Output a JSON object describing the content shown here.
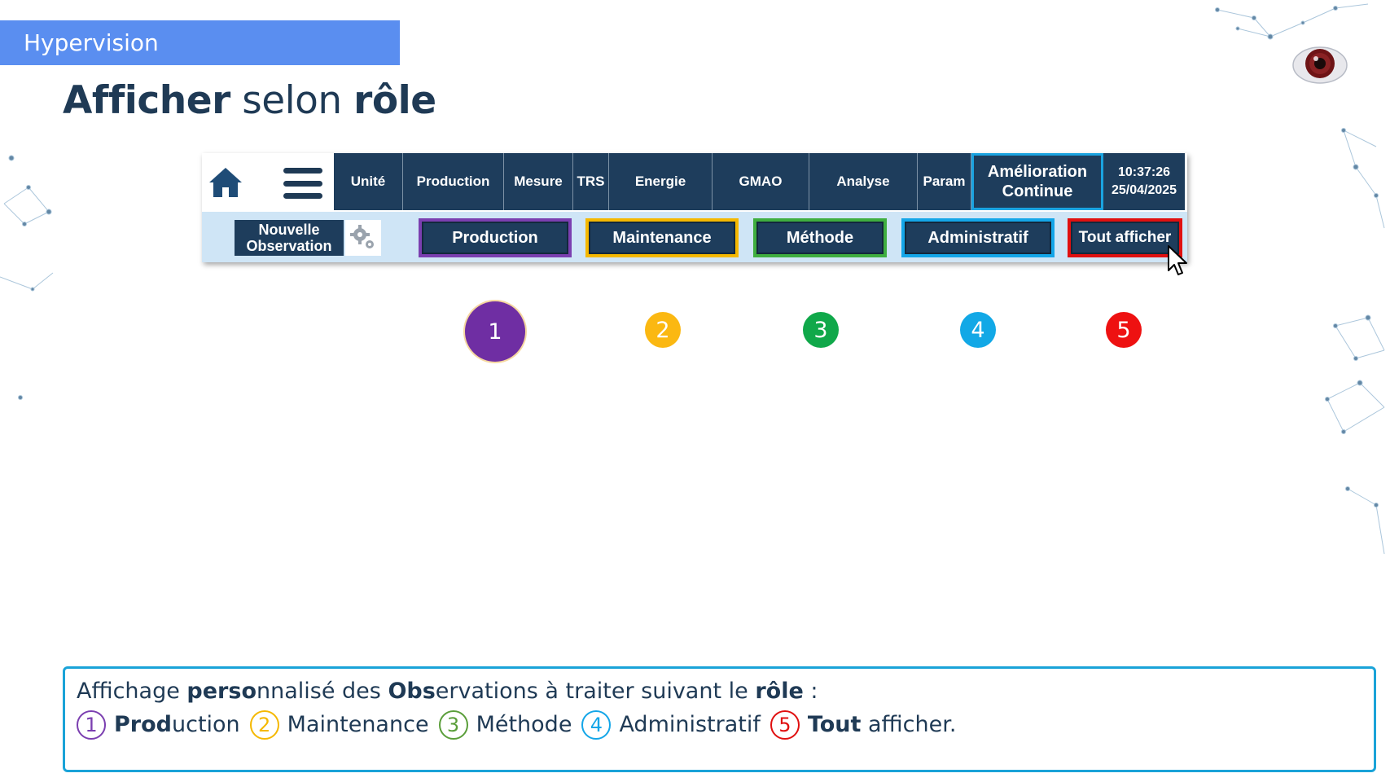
{
  "header": {
    "tag": "Hypervision"
  },
  "title": {
    "part1": "Afficher",
    "part2": " selon ",
    "part3": "rôle"
  },
  "toolbar": {
    "nav": [
      {
        "label": "Unité"
      },
      {
        "label": "Production"
      },
      {
        "label": "Mesure"
      },
      {
        "label": "TRS"
      },
      {
        "label": "Energie"
      },
      {
        "label": "GMAO"
      },
      {
        "label": "Analyse"
      },
      {
        "label": "Param"
      }
    ],
    "amelioration": {
      "line1": "Amélioration",
      "line2": "Continue"
    },
    "clock": {
      "time": "10:37:26",
      "date": "25/04/2025"
    },
    "new_observation": {
      "line1": "Nouvelle",
      "line2": "Observation"
    },
    "roles": [
      {
        "label": "Production",
        "color": "#7b3fb0"
      },
      {
        "label": "Maintenance",
        "color": "#f5b800"
      },
      {
        "label": "Méthode",
        "color": "#3fae3f"
      },
      {
        "label": "Administratif",
        "color": "#14a6e8"
      },
      {
        "label": "Tout afficher",
        "color": "#e01010"
      }
    ]
  },
  "markers": [
    {
      "label": "1",
      "color": "#6f2ea3"
    },
    {
      "label": "2",
      "color": "#fbb812"
    },
    {
      "label": "3",
      "color": "#10a84a"
    },
    {
      "label": "4",
      "color": "#12a8e6"
    },
    {
      "label": "5",
      "color": "#ee1111"
    }
  ],
  "description": {
    "line1": {
      "a": "Affichage ",
      "b": "perso",
      "c": "nnalisé des ",
      "d": "Obs",
      "e": "ervations à traiter suivant le ",
      "f": "rôle",
      "g": " :"
    },
    "items": [
      {
        "num": "1",
        "bold": "Prod",
        "rest": "uction",
        "color": "#7b3fb0"
      },
      {
        "num": "2",
        "bold": "",
        "rest": "Maintenance",
        "color": "#f5b800"
      },
      {
        "num": "3",
        "bold": "",
        "rest": "Méthode",
        "color": "#5a9e3a"
      },
      {
        "num": "4",
        "bold": "",
        "rest": "Administratif",
        "color": "#14a6e8"
      },
      {
        "num": "5",
        "bold": "Tout",
        "rest": " afficher.",
        "color": "#e01010"
      }
    ]
  }
}
